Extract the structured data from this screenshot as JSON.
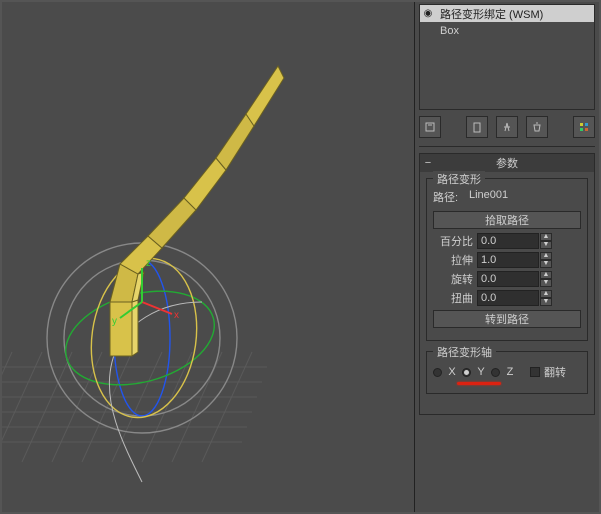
{
  "stack": {
    "items": [
      {
        "icon": "⚙",
        "label": "路径变形绑定 (WSM)"
      },
      {
        "icon": "",
        "label": "Box"
      }
    ]
  },
  "rollout": {
    "head_minus": "−",
    "title": "参数"
  },
  "pathdef": {
    "group_title": "路径变形",
    "path_label": "路径:",
    "path_value": "Line001",
    "pick_button": "拾取路径",
    "percent_label": "百分比",
    "percent_value": "0.0",
    "stretch_label": "拉伸",
    "stretch_value": "1.0",
    "rotate_label": "旋转",
    "rotate_value": "0.0",
    "twist_label": "扭曲",
    "twist_value": "0.0",
    "goto_button": "转到路径"
  },
  "axisgroup": {
    "group_title": "路径变形轴",
    "x": "X",
    "y": "Y",
    "z": "Z",
    "flip": "翻转",
    "selected": "Y"
  },
  "viewport_axes": {
    "x": "x",
    "y": "y",
    "z": "z"
  },
  "colors": {
    "accent_yellow": "#d8c24a",
    "grid": "#5a5a5a",
    "red_axis": "#e33",
    "green_axis": "#3c3",
    "blue_axis": "#66f",
    "highlight_red": "#d21"
  }
}
